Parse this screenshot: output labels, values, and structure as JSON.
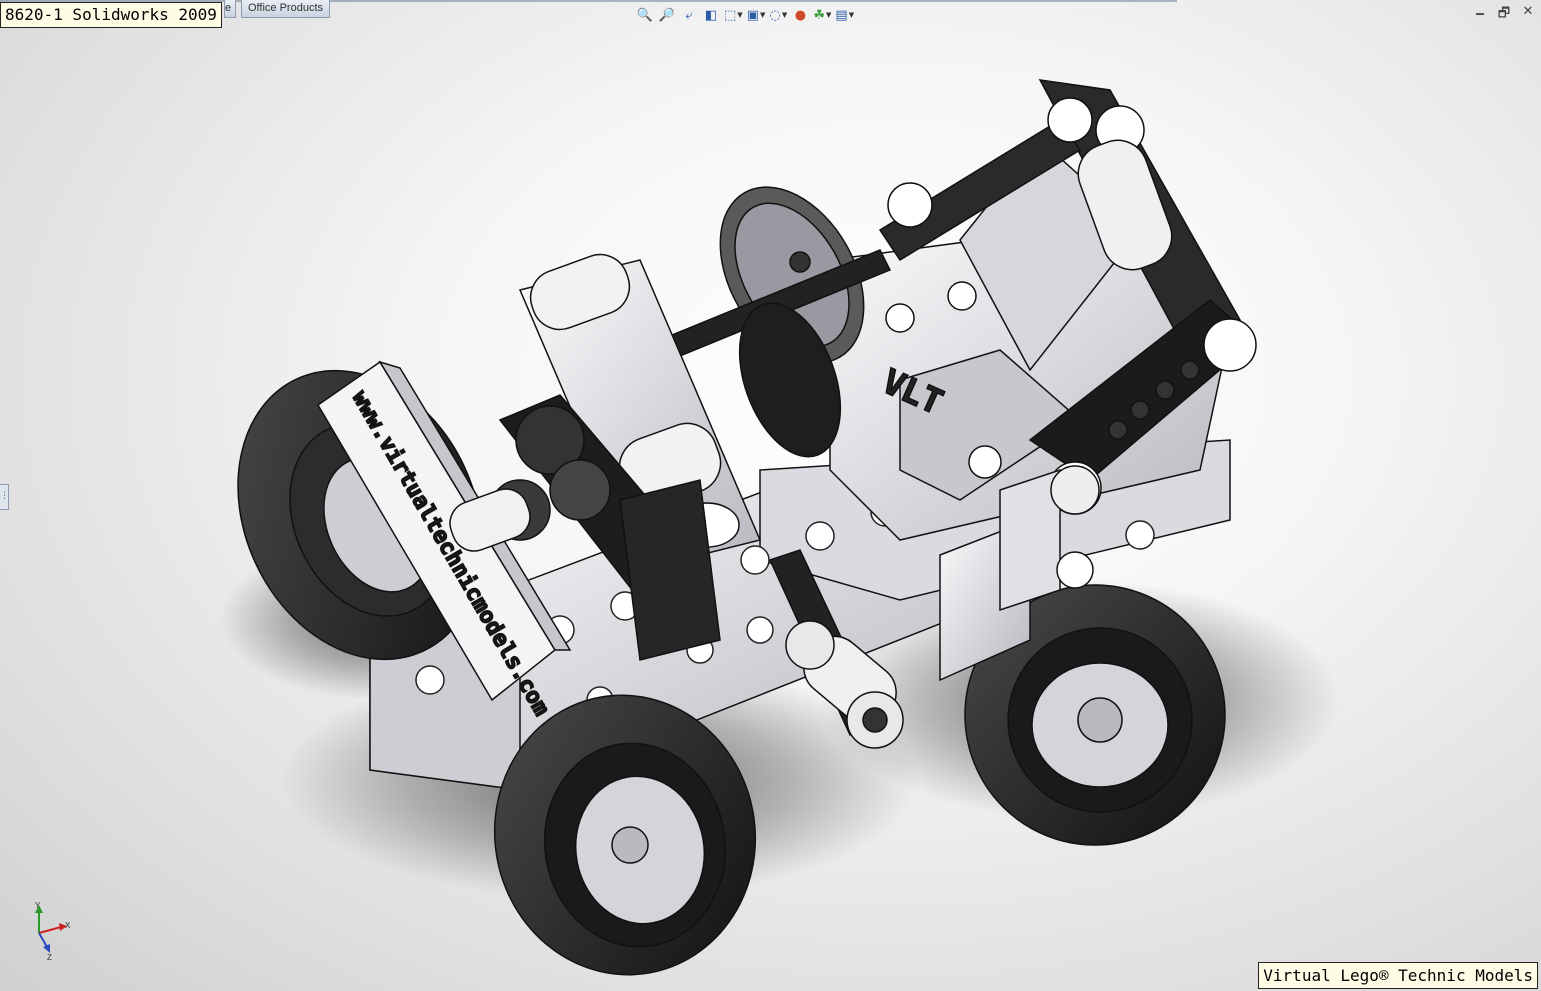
{
  "window": {
    "title_overlay": "8620-1 Solidworks 2009",
    "tabs": [
      {
        "label": "e"
      },
      {
        "label": "Office Products"
      }
    ],
    "controls": {
      "minimize": "🗕",
      "restore": "🗗",
      "close": "✕"
    }
  },
  "heads_up_toolbar": [
    {
      "icon": "zoom-to-fit-icon",
      "glyph": "🔍"
    },
    {
      "icon": "zoom-to-area-icon",
      "glyph": "🔎"
    },
    {
      "icon": "previous-view-icon",
      "glyph": "⤶"
    },
    {
      "icon": "section-view-icon",
      "glyph": "◧"
    },
    {
      "icon": "view-orientation-icon",
      "glyph": "⬚",
      "dropdown": true
    },
    {
      "icon": "display-style-icon",
      "glyph": "▣",
      "dropdown": true
    },
    {
      "icon": "hide-show-items-icon",
      "glyph": "◌",
      "dropdown": true
    },
    {
      "icon": "edit-appearance-icon",
      "glyph": "●"
    },
    {
      "icon": "apply-scene-icon",
      "glyph": "☘",
      "dropdown": true
    },
    {
      "icon": "view-settings-icon",
      "glyph": "▤",
      "dropdown": true
    }
  ],
  "model": {
    "brick_label_text": "www.virtualtechnicmodels.com",
    "seat_text": "VLT"
  },
  "triad": {
    "x": "X",
    "y": "Y",
    "z": "Z"
  },
  "watermark": "Virtual Lego® Technic Models",
  "colors": {
    "background_center": "#ffffff",
    "background_edge": "#d0d0d0",
    "part_light": "#e8e6ea",
    "part_mid": "#bdbac2",
    "part_dark": "#1e1e1e",
    "overlay_bg": "#fffce6"
  }
}
